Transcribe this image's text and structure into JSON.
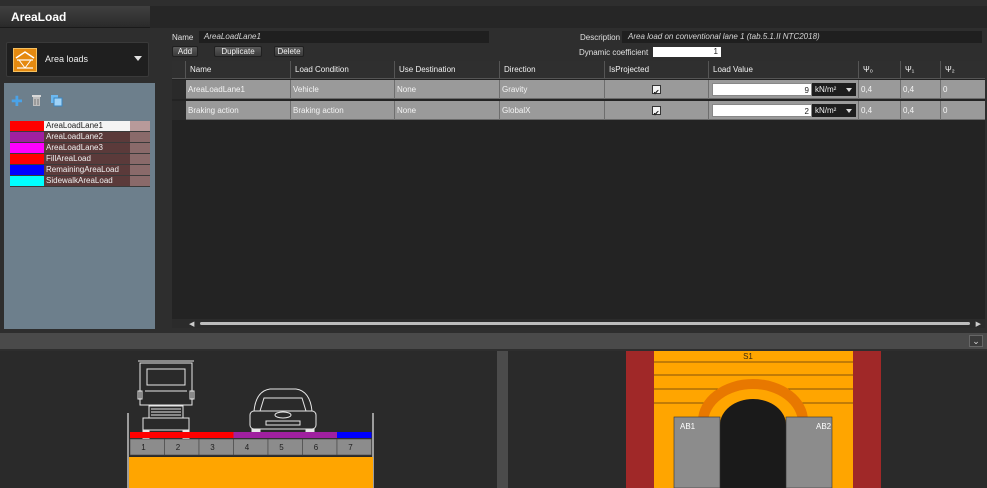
{
  "window": {
    "title": "AreaLoad"
  },
  "left_panel": {
    "combo_label": "Area loads",
    "combo_icon": "area-load-icon",
    "tools": [
      "add-icon",
      "delete-icon",
      "duplicate-icon"
    ],
    "loads": [
      {
        "name": "AreaLoadLane1",
        "color": "#ff0000",
        "selected": true
      },
      {
        "name": "AreaLoadLane2",
        "color": "#a020a0",
        "selected": false
      },
      {
        "name": "AreaLoadLane3",
        "color": "#ff00ff",
        "selected": false
      },
      {
        "name": "FillAreaLoad",
        "color": "#ff0000",
        "selected": false
      },
      {
        "name": "RemainingAreaLoad",
        "color": "#0000ff",
        "selected": false
      },
      {
        "name": "SidewalkAreaLoad",
        "color": "#00ffff",
        "selected": false
      }
    ]
  },
  "form": {
    "name_label": "Name",
    "name_value": "AreaLoadLane1",
    "description_label": "Description",
    "description_value": "Area load on conventional lane 1 (tab.5.1.II NTC2018)",
    "dynamic_label": "Dynamic coefficient",
    "dynamic_value": "1",
    "buttons": {
      "add": "Add",
      "duplicate": "Duplicate",
      "delete": "Delete"
    }
  },
  "grid": {
    "headers": [
      "Name",
      "Load Condition",
      "Use Destination",
      "Direction",
      "IsProjected",
      "Load Value",
      "Ψ₀",
      "Ψ₁",
      "Ψ₂"
    ],
    "rows": [
      {
        "name": "AreaLoadLane1",
        "condition": "Vehicle",
        "destination": "None",
        "direction": "Gravity",
        "projected": true,
        "value": "9",
        "unit": "kN/m²",
        "psi0": "0,4",
        "psi1": "0,4",
        "psi2": "0"
      },
      {
        "name": "Braking action",
        "condition": "Braking action",
        "destination": "None",
        "direction": "GlobalX",
        "projected": true,
        "value": "2",
        "unit": "kN/m²",
        "psi0": "0,4",
        "psi1": "0,4",
        "psi2": "0"
      }
    ]
  },
  "preview_left": {
    "lanes": [
      "1",
      "2",
      "3",
      "4",
      "5",
      "6",
      "7"
    ],
    "lane_colors": [
      "#ff0000",
      "#ff0000",
      "#ff0000",
      "#a020a0",
      "#a020a0",
      "#a020a0",
      "#0000ff"
    ],
    "fill_color": "#ffa500"
  },
  "preview_right": {
    "labels": {
      "top": "S1",
      "left": "AB1",
      "right": "AB2"
    },
    "fill_color": "#ffa500",
    "pier_color": "#a02828"
  }
}
